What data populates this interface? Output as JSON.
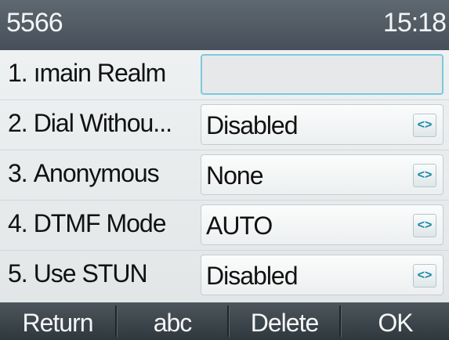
{
  "status_bar": {
    "account": "5566",
    "time": "15:18"
  },
  "rows": [
    {
      "number": "1.",
      "label": "ımain Realm",
      "value": "",
      "type": "input"
    },
    {
      "number": "2.",
      "label": "Dial Withou...",
      "value": "Disabled",
      "type": "select",
      "arrow_icon": "left-right-arrows-icon"
    },
    {
      "number": "3.",
      "label": "Anonymous",
      "value": "None",
      "type": "select",
      "arrow_icon": "left-right-arrows-icon"
    },
    {
      "number": "4.",
      "label": "DTMF Mode",
      "value": "AUTO",
      "type": "select",
      "arrow_icon": "left-right-arrows-icon"
    },
    {
      "number": "5.",
      "label": "Use STUN",
      "value": "Disabled",
      "type": "select",
      "arrow_icon": "left-right-arrows-icon"
    }
  ],
  "arrow_glyph": "<>",
  "softkeys": [
    {
      "label": "Return"
    },
    {
      "label": "abc"
    },
    {
      "label": "Delete"
    },
    {
      "label": "OK"
    }
  ],
  "colors": {
    "status_bar": "#4f5962",
    "accent_focus": "#7cc9dd",
    "arrow_icon": "#1a88a8",
    "softkey_bar": "#3a4349"
  }
}
